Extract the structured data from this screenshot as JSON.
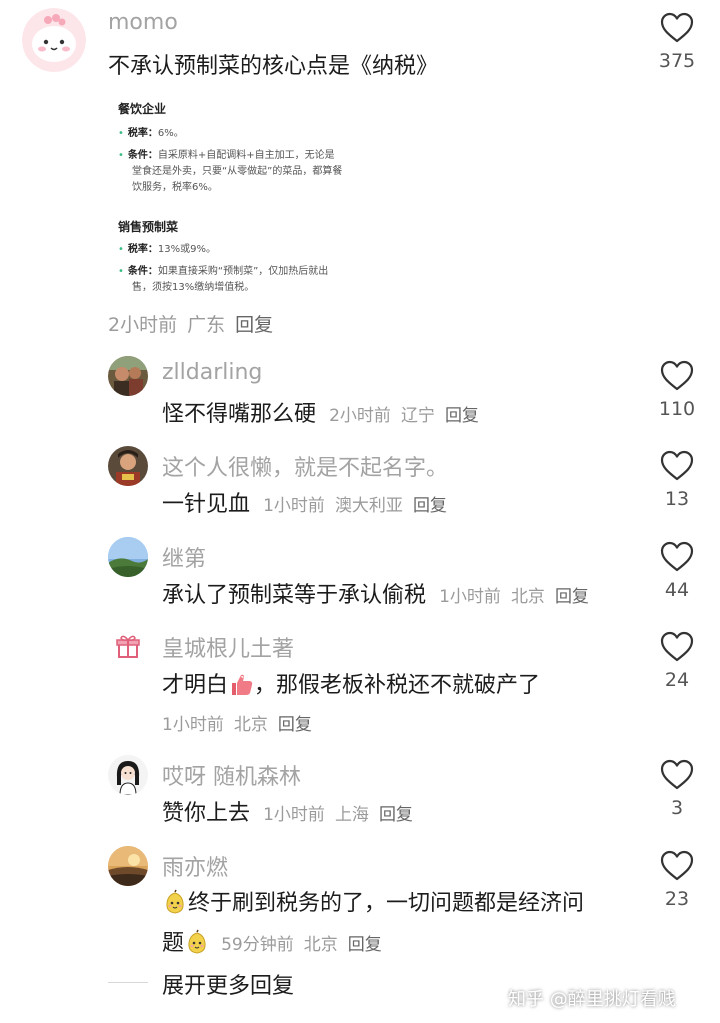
{
  "main_comment": {
    "username": "momo",
    "text": "不承认预制菜的核心点是《纳税》",
    "likes": "375",
    "time": "2小时前",
    "location": "广东",
    "reply_label": "回复",
    "embed": {
      "section1_title": "餐饮企业",
      "s1_item1_key": "税率：",
      "s1_item1_val": "6%。",
      "s1_item2_key": "条件：",
      "s1_item2_line1": "自采原料+自配调料+自主加工，无论是",
      "s1_item2_line2": "堂食还是外卖，只要“从零做起”的菜品，都算餐",
      "s1_item2_line3": "饮服务，税率6%。",
      "section2_title": "销售预制菜",
      "s2_item1_key": "税率：",
      "s2_item1_val": "13%或9%。",
      "s2_item2_key": "条件：",
      "s2_item2_line1": "如果直接采购“预制菜”，仅加热后就出",
      "s2_item2_line2": "售，须按13%缴纳增值税。"
    }
  },
  "replies": [
    {
      "username": "zlldarling",
      "text": "怪不得嘴那么硬",
      "time": "2小时前",
      "location": "辽宁",
      "reply_label": "回复",
      "likes": "110"
    },
    {
      "username": "这个人很懒，就是不起名字。",
      "text": "一针见血",
      "time": "1小时前",
      "location": "澳大利亚",
      "reply_label": "回复",
      "likes": "13"
    },
    {
      "username": "继第",
      "text": "承认了预制菜等于承认偷税",
      "time": "1小时前",
      "location": "北京",
      "reply_label": "回复",
      "likes": "44"
    },
    {
      "username": "皇城根儿土著",
      "text_before": "才明白",
      "text_after": "，那假老板补税还不就破产了",
      "time": "1小时前",
      "location": "北京",
      "reply_label": "回复",
      "likes": "24"
    },
    {
      "username": "哎呀 随机森林",
      "text": "赞你上去",
      "time": "1小时前",
      "location": "上海",
      "reply_label": "回复",
      "likes": "3"
    },
    {
      "username": "雨亦燃",
      "text_line1": "终于刷到税务的了，一切问题都是经济问",
      "text_line2": "题",
      "time": "59分钟前",
      "location": "北京",
      "reply_label": "回复",
      "likes": "23"
    }
  ],
  "expand_label": "展开更多回复",
  "watermark": "知乎 @醉里挑灯看贱",
  "colors": {
    "username": "#a3a3a3",
    "text": "#1c1c1c",
    "meta": "#9b9b9b",
    "heart_stroke": "#333333",
    "embed_bullet": "#3cbf86"
  },
  "icons": [
    "heart-icon",
    "gift-icon",
    "thumbs-up-emoji",
    "pear-emoji"
  ]
}
